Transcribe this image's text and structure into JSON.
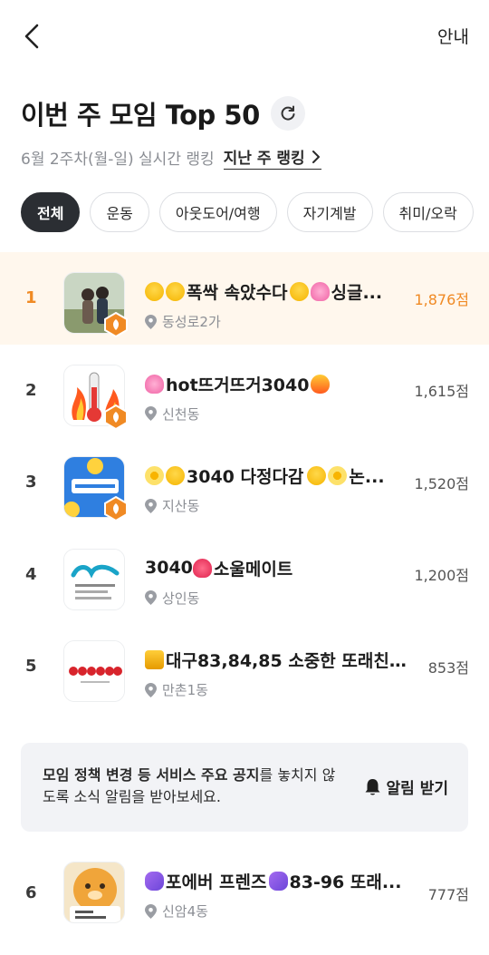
{
  "header": {
    "info_label": "안내"
  },
  "title": {
    "text": "이번 주 모임 Top 50"
  },
  "subtitle": {
    "period": "6월 2주차(월-일) 실시간 랭킹",
    "last_week_link": "지난 주 랭킹"
  },
  "categories": [
    "전체",
    "운동",
    "아웃도어/여행",
    "자기계발",
    "취미/오락"
  ],
  "active_category": "전체",
  "rankings": [
    {
      "rank": "1",
      "emojis": [
        "laugh",
        "laugh"
      ],
      "name": "폭싹 속았수다😍🥰싱글...",
      "name_text": "폭싹 속았수다",
      "trail_emojis": [
        "laugh",
        "heart"
      ],
      "trail_text": "싱글...",
      "location": "동성로2가",
      "score": "1,876점",
      "highlight": true
    },
    {
      "rank": "2",
      "emojis": [
        "heart"
      ],
      "name_text": "hot뜨거뜨거3040",
      "trail_emojis": [
        "fire"
      ],
      "trail_text": "",
      "location": "신천동",
      "score": "1,615점"
    },
    {
      "rank": "3",
      "emojis": [
        "flower",
        "laugh"
      ],
      "name_text": "3040 다정다감 ",
      "trail_emojis": [
        "laugh",
        "flower"
      ],
      "trail_text": "논...",
      "location": "지산동",
      "score": "1,520점"
    },
    {
      "rank": "4",
      "emojis": [],
      "name_text": "3040",
      "trail_emojis": [
        "heart"
      ],
      "trail_text": "소울메이트",
      "location": "상인동",
      "score": "1,200점"
    },
    {
      "rank": "5",
      "emojis": [
        "crown"
      ],
      "name_text": "대구83,84,85 소중한 또래친...",
      "trail_emojis": [],
      "trail_text": "",
      "location": "만촌1동",
      "score": "853점"
    }
  ],
  "notice": {
    "bold_text": "모임 정책 변경 등 서비스 주요 공지",
    "rest_text": "를 놓치지 않도록 소식 알림을 받아보세요.",
    "button_label": "알림 받기"
  },
  "rankings_after_notice": [
    {
      "rank": "6",
      "emojis": [
        "note"
      ],
      "name_text": "포에버 프렌즈",
      "trail_emojis": [
        "note"
      ],
      "trail_text": "83-96 또래...",
      "location": "신암4동",
      "score": "777점"
    }
  ],
  "colors": {
    "accent": "#f08a24",
    "highlight_bg": "#fff7ed",
    "chip_active": "#2b2e33",
    "notice_bg": "#f2f3f6"
  }
}
